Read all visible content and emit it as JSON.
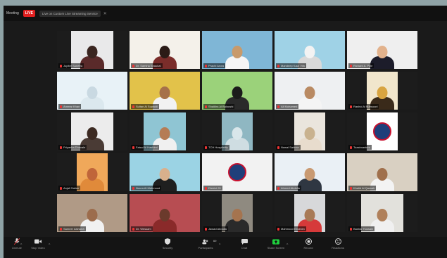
{
  "topbar": {
    "window_label": "Meeting",
    "live_badge": "LIVE",
    "stream_text": "Live on Custom Live Streaming Service"
  },
  "tiles": [
    {
      "name": "Jupiter Sunetra",
      "bg": "#e9e9ea",
      "fg_head": "#3a2520",
      "fg_body": "#5a2a2a",
      "kind": "center"
    },
    {
      "name": "Dr. Samina Shaukat",
      "bg": "#f4f1ea",
      "fg_head": "#2b1b16",
      "fg_body": "#7a2d2a",
      "kind": "full"
    },
    {
      "name": "Prachi Arora",
      "bg": "#7fb6d6",
      "fg_head": "#c89a6b",
      "fg_body": "#f5f5f5",
      "kind": "full"
    },
    {
      "name": "Mandeep Kaur Virk",
      "bg": "#9fd2e6",
      "fg_head": "#f3f3f3",
      "fg_body": "#d9d9d9",
      "kind": "full"
    },
    {
      "name": "Richard A. Pyle",
      "bg": "#efefef",
      "fg_head": "#e2b28c",
      "fg_body": "#1c1c2a",
      "kind": "full"
    },
    {
      "name": "Ammar Khan",
      "bg": "#e8f2f7",
      "fg_head": "#c9d9e2",
      "fg_body": "#dbe8ee",
      "kind": "full"
    },
    {
      "name": "Sultan Al Suwaidi",
      "bg": "#e2c24a",
      "fg_head": "#a6714a",
      "fg_body": "#f2f2f2",
      "kind": "full"
    },
    {
      "name": "Shaikha Al Baloushi",
      "bg": "#9bd27a",
      "fg_head": "#1b1b1b",
      "fg_body": "#2a2a2a",
      "kind": "full"
    },
    {
      "name": "Ali Mohamed",
      "bg": "#eef0f2",
      "fg_head": "#b98a63",
      "fg_body": "#f4f4f4",
      "kind": "full"
    },
    {
      "name": "Rashid Al Mansoori",
      "bg": "#f1e6cc",
      "fg_head": "#d8a441",
      "fg_body": "#3a2a1a",
      "kind": "narrow"
    },
    {
      "name": "Priyanka Dhavale",
      "bg": "#ececec",
      "fg_head": "#3c2a22",
      "fg_body": "#4a3b35",
      "kind": "center"
    },
    {
      "name": "Faisal Al Hashimi",
      "bg": "#8fc5d3",
      "fg_head": "#b57c55",
      "fg_body": "#f0f0f0",
      "kind": "center"
    },
    {
      "name": "TCH Hospitality",
      "bg": "#8fb7c2",
      "fg_head": "#d9e6ea",
      "fg_body": "#cfdde2",
      "kind": "narrow"
    },
    {
      "name": "Nawal Salman",
      "bg": "#eae5dd",
      "fg_head": "#c9b28f",
      "fg_body": "#e8dccd",
      "kind": "narrow"
    },
    {
      "name": "Toastmasters",
      "bg": "#ffffff",
      "fg_head": "#1f3f7a",
      "fg_body": "#ffffff",
      "kind": "narrow"
    },
    {
      "name": "Anjali Salian",
      "bg": "#f0a85a",
      "fg_head": "#c0653a",
      "fg_body": "#e08a3a",
      "kind": "narrow"
    },
    {
      "name": "Noura Al Mahmood",
      "bg": "#9bd3e4",
      "fg_head": "#d9b08c",
      "fg_body": "#1f1f1f",
      "kind": "full"
    },
    {
      "name": "District 20",
      "bg": "#f2f2f2",
      "fg_head": "#1f3f7a",
      "fg_body": "#f2f2f2",
      "kind": "full"
    },
    {
      "name": "Ahmed Abdulla",
      "bg": "#eaf0f5",
      "fg_head": "#c99a72",
      "fg_body": "#2f3742",
      "kind": "full"
    },
    {
      "name": "Khalid Al Qassab",
      "bg": "#d9d0c2",
      "fg_head": "#a0704c",
      "fg_body": "#f3f3f3",
      "kind": "full"
    },
    {
      "name": "Sameer Alshaikh",
      "bg": "#b09a86",
      "fg_head": "#9c6c4c",
      "fg_body": "#f1f1f1",
      "kind": "full"
    },
    {
      "name": "Dr. Wessam",
      "bg": "#b74d52",
      "fg_head": "#6b3a2c",
      "fg_body": "#8a2a2a",
      "kind": "full"
    },
    {
      "name": "Jawad Abdulla",
      "bg": "#8f8a80",
      "fg_head": "#a5744f",
      "fg_body": "#2a2a2a",
      "kind": "narrow"
    },
    {
      "name": "Mahmood Ebrahim",
      "bg": "#d7d8da",
      "fg_head": "#a87a56",
      "fg_body": "#d63a3a",
      "kind": "narrow"
    },
    {
      "name": "Bashar Hussain",
      "bg": "#e2e1dc",
      "fg_head": "#b0805a",
      "fg_body": "#f0f0f0",
      "kind": "center"
    }
  ],
  "toolbar": {
    "unmute": "Unmute",
    "start_video": "Stop Video",
    "security": "Security",
    "participants": "Participants",
    "participant_count": "69",
    "chat": "Chat",
    "share_screen": "Share Screen",
    "record": "Record",
    "reactions": "Reactions"
  }
}
